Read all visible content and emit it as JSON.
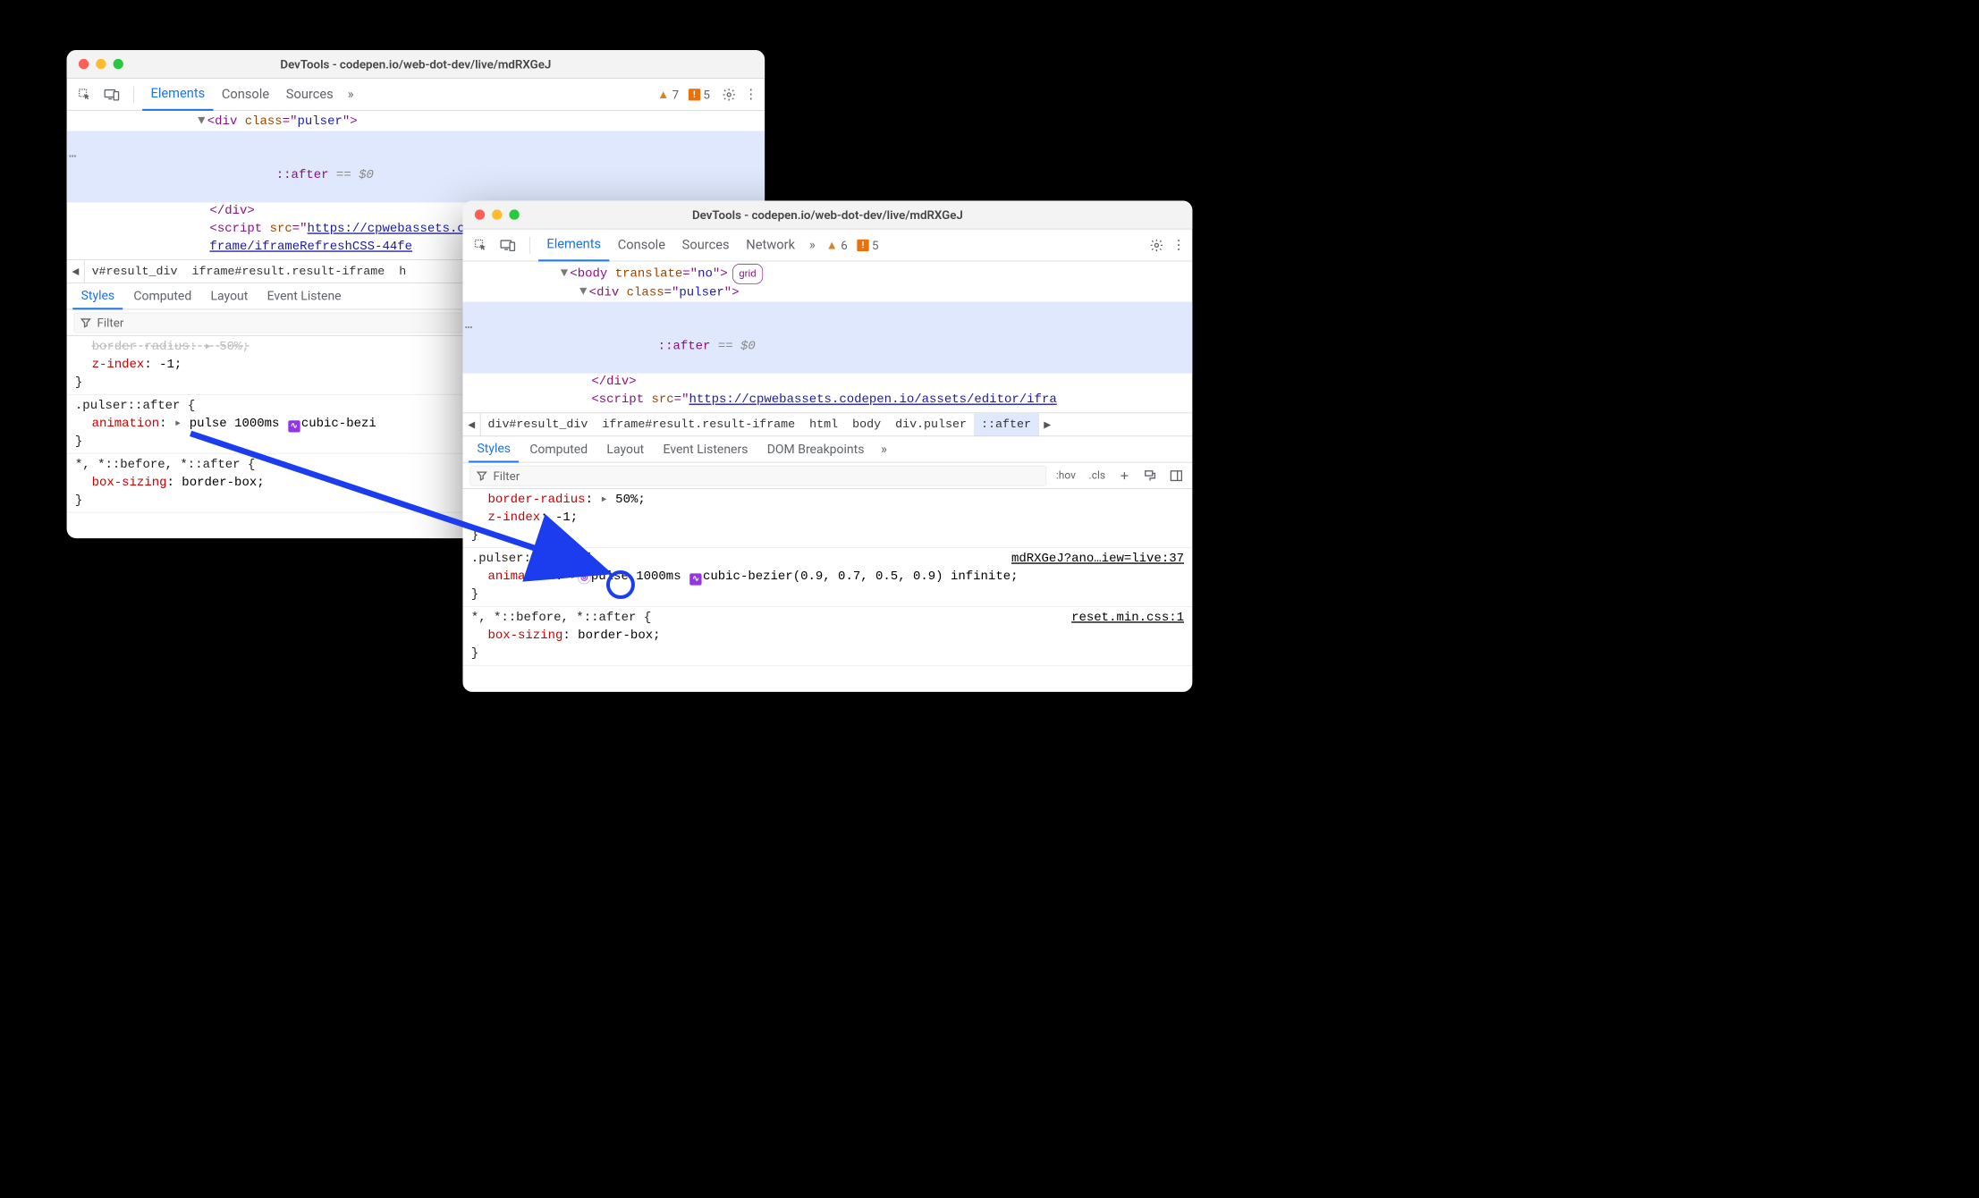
{
  "window": {
    "title": "DevTools - codepen.io/web-dot-dev/live/mdRXGeJ"
  },
  "toolbar": {
    "tabs": {
      "elements": "Elements",
      "console": "Console",
      "sources": "Sources",
      "network": "Network"
    },
    "warnings1": "7",
    "errors1": "5",
    "warnings2": "6",
    "errors2": "5"
  },
  "dom": {
    "body_open": "<body translate=\"no\">",
    "div_open": "<div class=\"pulser\">",
    "after": "::after",
    "eq0": "== $0",
    "div_close": "</div>",
    "script_open_1": "<script src=\"",
    "script_url_1a": "https://cpwebassets.codepen.io/assets/editor/i",
    "script_url_1b": "frame/iframeRefreshCSS-44fe",
    "script_url_2": "https://cpwebassets.codepen.io/assets/editor/ifra",
    "grid_chip": "grid"
  },
  "crumbs": {
    "a": "v#result_div",
    "b": "iframe#result.result-iframe",
    "c": "h",
    "full": {
      "a": "div#result_div",
      "b": "iframe#result.result-iframe",
      "c": "html",
      "d": "body",
      "e": "div.pulser",
      "f": "::after"
    }
  },
  "subtabs": {
    "styles": "Styles",
    "computed": "Computed",
    "layout": "Layout",
    "listeners": "Event Listeners",
    "listeners_short": "Event Listene",
    "dombp": "DOM Breakpoints"
  },
  "filter": {
    "placeholder": "Filter",
    "hov": ":hov",
    "cls": ".cls"
  },
  "rules": {
    "r0_partial": "border-radius:  ▸ 50%;",
    "zindex_prop": "z-index",
    "zindex_val": "-1",
    "pulser_sel": ".pulser::after",
    "anim_prop": "animation",
    "anim_name": "pulse",
    "anim_dur": "1000ms",
    "anim_cb_trunc": "cubic-bezi",
    "anim_cb_full": "cubic-bezier(0.9, 0.7, 0.5, 0.9)",
    "anim_inf": "infinite",
    "uni_sel": "*, *::before, *::after",
    "box_prop": "box-sizing",
    "box_val": "border-box",
    "br_prop": "border-radius",
    "br_val": "50%",
    "src1": "mdRXGeJ?ano…iew=live:37",
    "src2": "reset.min.css:1"
  }
}
